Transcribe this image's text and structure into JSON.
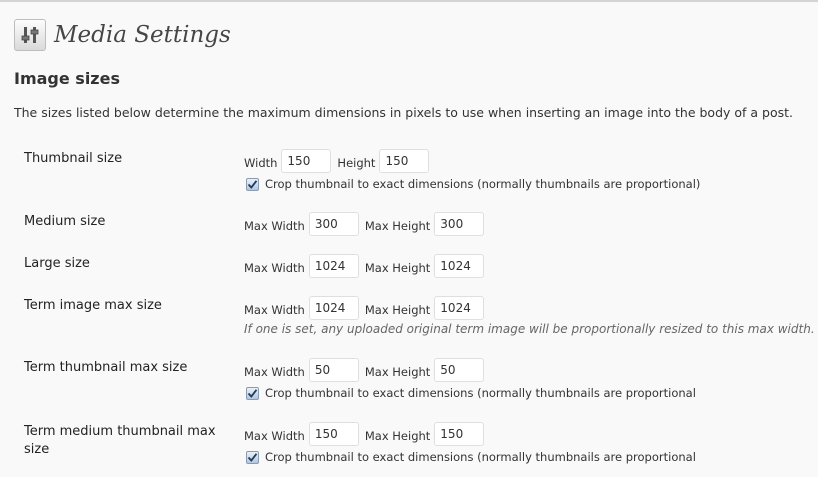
{
  "page": {
    "title": "Media Settings",
    "section_title": "Image sizes",
    "description": "The sizes listed below determine the maximum dimensions in pixels to use when inserting an image into the body of a post."
  },
  "icons": {
    "settings": "settings-sliders-icon",
    "check": "checkmark-icon"
  },
  "sizes": {
    "thumbnail": {
      "label": "Thumbnail size",
      "width_label": "Width",
      "width": "150",
      "height_label": "Height",
      "height": "150",
      "crop_checked": true,
      "crop_label": "Crop thumbnail to exact dimensions (normally thumbnails are proportional)"
    },
    "medium": {
      "label": "Medium size",
      "width_label": "Max Width",
      "width": "300",
      "height_label": "Max Height",
      "height": "300"
    },
    "large": {
      "label": "Large size",
      "width_label": "Max Width",
      "width": "1024",
      "height_label": "Max Height",
      "height": "1024"
    },
    "term_image": {
      "label": "Term image max size",
      "width_label": "Max Width",
      "width": "1024",
      "height_label": "Max Height",
      "height": "1024",
      "note": "If one is set, any uploaded original term image will be proportionally resized to this max width."
    },
    "term_thumbnail": {
      "label": "Term thumbnail max size",
      "width_label": "Max Width",
      "width": "50",
      "height_label": "Max Height",
      "height": "50",
      "crop_checked": true,
      "crop_label": "Crop thumbnail to exact dimensions (normally thumbnails are proportional"
    },
    "term_medium_thumbnail": {
      "label_line1": "Term medium thumbnail max",
      "label_line2": "size",
      "width_label": "Max Width",
      "width": "150",
      "height_label": "Max Height",
      "height": "150",
      "crop_checked": true,
      "crop_label": "Crop thumbnail to exact dimensions (normally thumbnails are proportional"
    }
  }
}
